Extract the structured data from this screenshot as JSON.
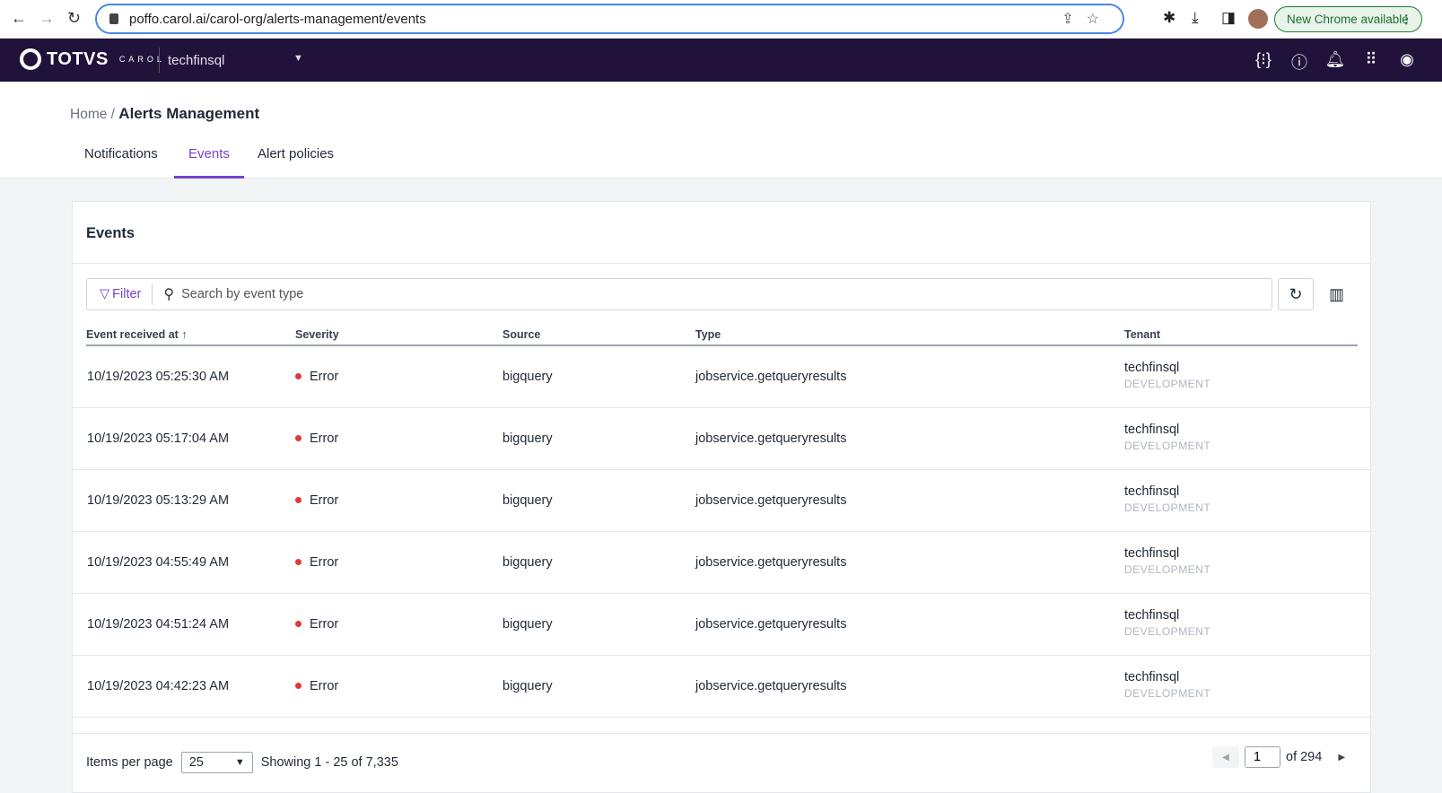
{
  "browser": {
    "url": "poffo.carol.ai/carol-org/alerts-management/events",
    "update_label": "New Chrome available"
  },
  "nav": {
    "logo": "TOTVS",
    "logo_sub": "CAROL",
    "tenant": "techfinsql"
  },
  "breadcrumb": {
    "home": "Home",
    "separator": "/",
    "current": "Alerts Management"
  },
  "tabs": [
    {
      "label": "Notifications"
    },
    {
      "label": "Events",
      "active": true
    },
    {
      "label": "Alert policies"
    }
  ],
  "card": {
    "title": "Events",
    "filter_label": "Filter",
    "search_placeholder": "Search by event type"
  },
  "table": {
    "columns": [
      "Event received at",
      "Severity",
      "Source",
      "Type",
      "Tenant"
    ],
    "sort_indicator": "↑",
    "rows": [
      {
        "received": "10/19/2023 05:25:30 AM",
        "severity": "Error",
        "source": "bigquery",
        "type": "jobservice.getqueryresults",
        "tenant": "techfinsql",
        "env": "DEVELOPMENT"
      },
      {
        "received": "10/19/2023 05:17:04 AM",
        "severity": "Error",
        "source": "bigquery",
        "type": "jobservice.getqueryresults",
        "tenant": "techfinsql",
        "env": "DEVELOPMENT"
      },
      {
        "received": "10/19/2023 05:13:29 AM",
        "severity": "Error",
        "source": "bigquery",
        "type": "jobservice.getqueryresults",
        "tenant": "techfinsql",
        "env": "DEVELOPMENT"
      },
      {
        "received": "10/19/2023 04:55:49 AM",
        "severity": "Error",
        "source": "bigquery",
        "type": "jobservice.getqueryresults",
        "tenant": "techfinsql",
        "env": "DEVELOPMENT"
      },
      {
        "received": "10/19/2023 04:51:24 AM",
        "severity": "Error",
        "source": "bigquery",
        "type": "jobservice.getqueryresults",
        "tenant": "techfinsql",
        "env": "DEVELOPMENT"
      },
      {
        "received": "10/19/2023 04:42:23 AM",
        "severity": "Error",
        "source": "bigquery",
        "type": "jobservice.getqueryresults",
        "tenant": "techfinsql",
        "env": "DEVELOPMENT"
      }
    ]
  },
  "footer": {
    "items_per_page_label": "Items per page",
    "items_per_page": "25",
    "showing": "Showing 1 - 25 of 7,335",
    "page": "1",
    "of_pages": "of 294"
  },
  "colors": {
    "nav_bg": "#20123a",
    "accent": "#7444c8",
    "error": "#e5373a"
  }
}
